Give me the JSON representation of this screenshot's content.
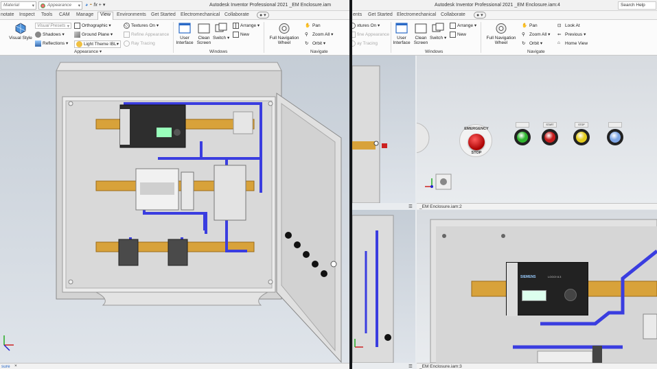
{
  "left_window": {
    "title": "Autodesk Inventor Professional 2021    _EM Enclosure.iam",
    "material_field": "Material",
    "appearance_field": "Appearance",
    "tabs": [
      "notate",
      "Inspect",
      "Tools",
      "CAM",
      "Manage",
      "View",
      "Environments",
      "Get Started",
      "Electromechanical",
      "Collaborate"
    ],
    "active_tab": "View",
    "ribbon": {
      "visual_style": "Visual Style",
      "visual_presets": "Visual Presets",
      "shadows": "Shadows",
      "reflections": "Reflections",
      "orthographic": "Orthographic",
      "ground_plane": "Ground Plane",
      "light_theme": "Light Theme IBL",
      "textures_on": "Textures On",
      "refine_appearance": "Refine Appearance",
      "ray_tracing": "Ray Tracing",
      "appearance_panel": "Appearance",
      "user_interface": "User\nInterface",
      "clean_screen": "Clean\nScreen",
      "switch": "Switch",
      "arrange": "Arrange",
      "new": "New",
      "windows_panel": "Windows",
      "full_nav_wheel": "Full Navigation\nWheel",
      "pan": "Pan",
      "zoom_all": "Zoom All",
      "orbit": "Orbit",
      "navigate_panel": "Navigate"
    },
    "footer_tab": "sure",
    "footer_close": "×"
  },
  "right_window": {
    "title": "Autodesk Inventor Professional 2021    _EM Enclosure.iam:4",
    "search": "Search Help",
    "tabs": [
      "ents",
      "Get Started",
      "Electromechanical",
      "Collaborate"
    ],
    "ribbon": {
      "textures_on": "xtures On",
      "refine_appearance": "fine Appearance",
      "ray_tracing": "ay Tracing",
      "user_interface": "User\nInterface",
      "clean_screen": "Clean\nScreen",
      "switch": "Switch",
      "arrange": "Arrange",
      "new": "New",
      "windows_panel": "Windows",
      "full_nav_wheel": "Full Navigation\nWheel",
      "pan": "Pan",
      "zoom_all": "Zoom All",
      "orbit": "Orbit",
      "look_at": "Look At",
      "previous": "Previous",
      "home_view": "Home View",
      "navigate_panel": "Navigate"
    },
    "top_viewport_tab": "_EM Enclosure.iam:2",
    "bottom_viewport_tab": "_EM Enclosure.iam:3",
    "emergency_label_top": "EMERGENCY",
    "emergency_label_bottom": "STOP",
    "button_labels": [
      "START",
      "STOP"
    ],
    "pilot_colors": [
      "#2fb52f",
      "#c61d1d",
      "#e3cc1f",
      "#7fa7e6"
    ],
    "plc_brand": "SIEMENS",
    "plc_model": "LOGO! 8.3"
  },
  "colors": {
    "wire": "#3a3de0",
    "rail": "#d8a23a",
    "cabinet": "#dcdcdc"
  }
}
